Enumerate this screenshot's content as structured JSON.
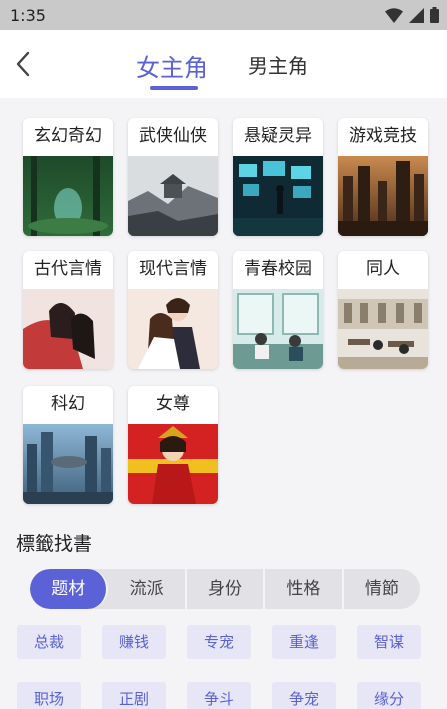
{
  "status_bar": {
    "time": "1:35"
  },
  "header": {
    "back_icon": "chevron-left-icon",
    "tabs": [
      {
        "label": "女主角",
        "active": true
      },
      {
        "label": "男主角",
        "active": false
      }
    ],
    "accent_color": "#5b61d6"
  },
  "categories": [
    {
      "label": "玄幻奇幻"
    },
    {
      "label": "武侠仙侠"
    },
    {
      "label": "悬疑灵异"
    },
    {
      "label": "游戏竞技"
    },
    {
      "label": "古代言情"
    },
    {
      "label": "现代言情"
    },
    {
      "label": "青春校园"
    },
    {
      "label": "同人"
    },
    {
      "label": "科幻"
    },
    {
      "label": "女尊"
    }
  ],
  "tag_section": {
    "title": "標籤找書",
    "segments": [
      {
        "label": "题材",
        "active": true
      },
      {
        "label": "流派",
        "active": false
      },
      {
        "label": "身份",
        "active": false
      },
      {
        "label": "性格",
        "active": false
      },
      {
        "label": "情節",
        "active": false
      }
    ],
    "tags": [
      "总裁",
      "赚钱",
      "专宠",
      "重逢",
      "智谋",
      "职场",
      "正剧",
      "争斗",
      "争宠",
      "缘分"
    ]
  }
}
